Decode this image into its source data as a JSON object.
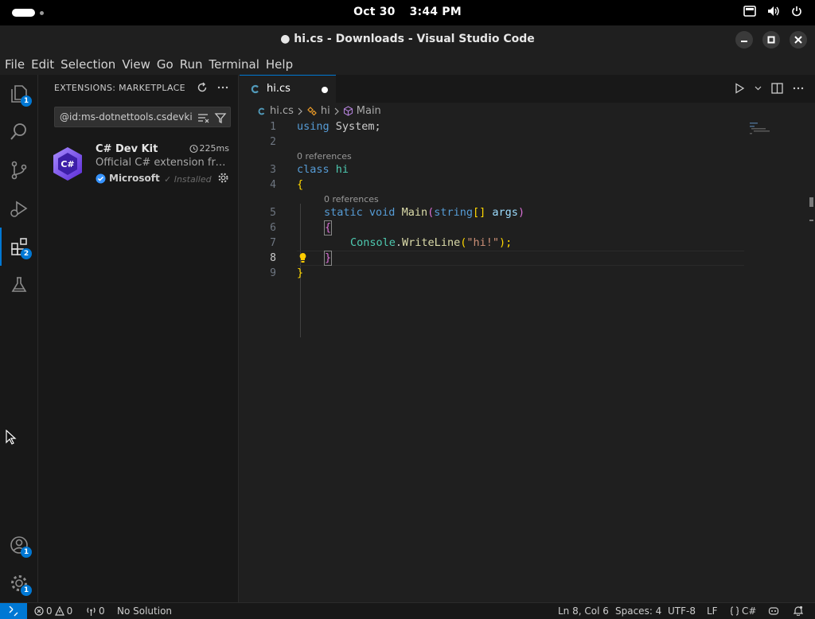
{
  "system": {
    "date": "Oct 30",
    "time": "3:44 PM"
  },
  "window": {
    "title": "● hi.cs - Downloads - Visual Studio Code"
  },
  "menu": [
    "File",
    "Edit",
    "Selection",
    "View",
    "Go",
    "Run",
    "Terminal",
    "Help"
  ],
  "activity_bar": {
    "explorer_badge": "1",
    "extensions_badge": "2",
    "accounts_badge": "1",
    "manage_badge": "1"
  },
  "sidebar": {
    "header": "EXTENSIONS: MARKETPLACE",
    "search_value": "@id:ms-dotnettools.csdevkit",
    "extension": {
      "logo_text": "C#",
      "name": "C# Dev Kit",
      "time": "225ms",
      "description": "Official C# extension from Microsoft",
      "publisher": "Microsoft",
      "status": "✓ Installed"
    }
  },
  "editor": {
    "tab_label": "hi.cs",
    "breadcrumb": [
      "hi.cs",
      "hi",
      "Main"
    ],
    "code_lens": "0 references",
    "line_numbers": [
      "1",
      "2",
      "3",
      "4",
      "5",
      "6",
      "7",
      "8",
      "9"
    ],
    "code": {
      "l1_kw": "using",
      "l1_rest": " System;",
      "l3_kw": "class",
      "l3_name": "hi",
      "l4": "{",
      "l5_static": "static",
      "l5_void": "void",
      "l5_main": "Main",
      "l5_paren_open": "(",
      "l5_string": "string",
      "l5_brackets": "[]",
      "l5_args": "args",
      "l5_paren_close": ")",
      "l6": "{",
      "l7_console": "Console",
      "l7_dot": ".",
      "l7_writeline": "WriteLine",
      "l7_paren_open": "(",
      "l7_str": "\"hi!\"",
      "l7_end": ");",
      "l7_semicolon": "",
      "l8": "}",
      "l9": "}"
    }
  },
  "statusbar": {
    "errors": "0",
    "warnings": "0",
    "ports": "0",
    "solution": "No Solution",
    "position": "Ln 8, Col 6",
    "spaces": "Spaces: 4",
    "encoding": "UTF-8",
    "eol": "LF",
    "language": "C#"
  }
}
